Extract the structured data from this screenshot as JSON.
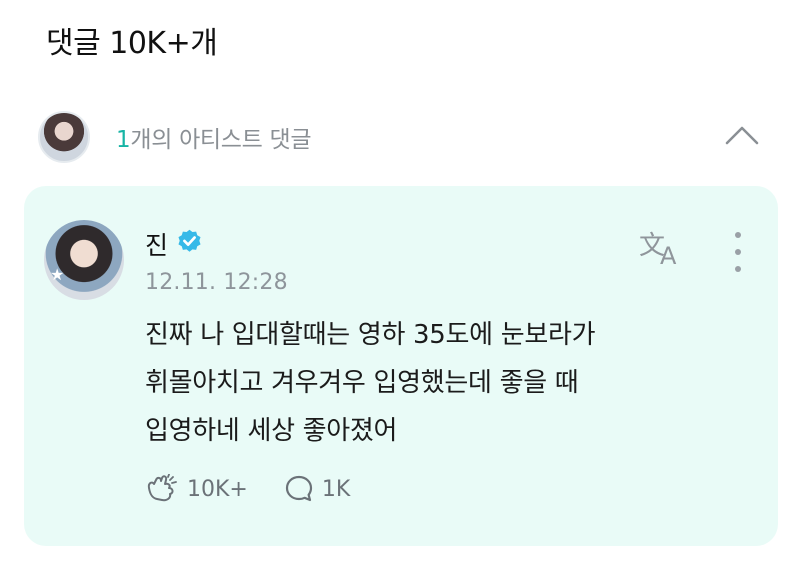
{
  "header": {
    "title": "댓글 10K+개"
  },
  "artist_comments": {
    "count": "1",
    "label": "개의 아티스트 댓글"
  },
  "comment": {
    "author": "진",
    "timestamp": "12.11. 12:28",
    "lines": [
      "진짜 나 입대할때는 영하 35도에 눈보라가",
      "휘몰아치고 겨우겨우 입영했는데 좋을 때",
      "입영하네 세상 좋아졌어"
    ],
    "likes": "10K+",
    "replies": "1K"
  },
  "colors": {
    "accent": "#17b4a5",
    "card_background": "#e9fbf7",
    "verified_badge": "#36b9e8"
  },
  "icons": {
    "collapse": "chevron-up-icon",
    "translate": "translate-icon",
    "more": "more-vertical-icon",
    "like": "cheer-icon",
    "reply": "comment-bubble-icon",
    "verified": "verified-badge-icon"
  }
}
